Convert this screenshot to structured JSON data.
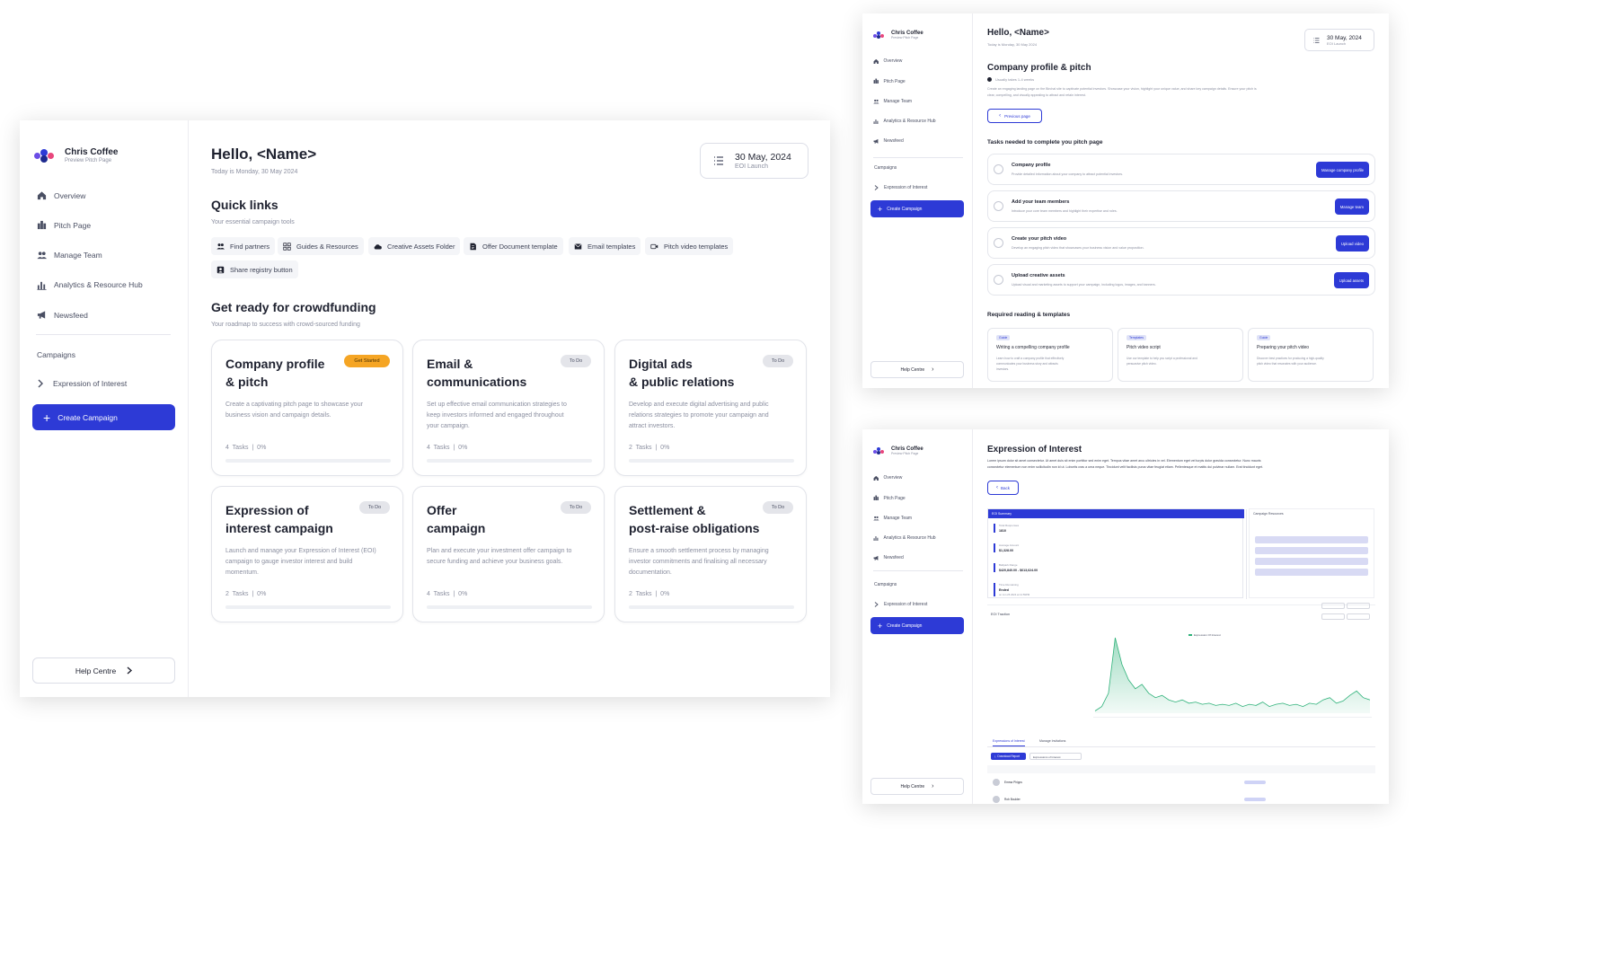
{
  "brand": {
    "name": "Chris Coffee",
    "sub": "Preview Pitch Page"
  },
  "nav": [
    {
      "label": "Overview",
      "icon": "home-icon"
    },
    {
      "label": "Pitch Page",
      "icon": "pitch-page-icon"
    },
    {
      "label": "Manage Team",
      "icon": "team-icon"
    },
    {
      "label": "Analytics & Resource Hub",
      "icon": "analytics-icon"
    },
    {
      "label": "Newsfeed",
      "icon": "megaphone-icon"
    }
  ],
  "campaigns": {
    "heading": "Campaigns",
    "item": "Expression of Interest",
    "create": "Create Campaign"
  },
  "help": "Help Centre",
  "header": {
    "hello": "Hello, <Name>",
    "today": "Today is Monday, 30 May 2024",
    "date": "30 May, 2024",
    "phase": "EOI Launch"
  },
  "quick_links": {
    "title": "Quick links",
    "sub": "Your essential campaign tools",
    "items": [
      {
        "label": "Find partners",
        "icon": "users-icon"
      },
      {
        "label": "Guides & Resources",
        "icon": "grid-icon"
      },
      {
        "label": "Creative Assets Folder",
        "icon": "cloud-icon"
      },
      {
        "label": "Offer Document template",
        "icon": "document-icon"
      },
      {
        "label": "Email templates",
        "icon": "mail-icon"
      },
      {
        "label": "Pitch video templates",
        "icon": "video-icon"
      },
      {
        "label": "Share registry button",
        "icon": "share-user-icon"
      }
    ]
  },
  "ready": {
    "title": "Get ready for crowdfunding",
    "sub": "Your roadmap to success with crowd-sourced funding"
  },
  "cards": [
    {
      "t1": "Company profile",
      "t2": "& pitch",
      "badge": "Get Started",
      "badge_color": "#f5a524",
      "desc": [
        "Create a captivating pitch page to showcase your",
        "business vision and campaign details."
      ],
      "tasks": "4  Tasks",
      "pct": "0%"
    },
    {
      "t1": "Email &",
      "t2": "communications",
      "badge": "To Do",
      "badge_color": "#e4e5ea",
      "desc": [
        "Set up effective email communication strategies to",
        "keep investors informed and engaged throughout",
        "your campaign."
      ],
      "tasks": "4  Tasks",
      "pct": "0%"
    },
    {
      "t1": "Digital ads",
      "t2": "& public relations",
      "badge": "To Do",
      "badge_color": "#e4e5ea",
      "desc": [
        "Develop and execute digital advertising and public",
        "relations strategies to promote your campaign and",
        "attract investors."
      ],
      "tasks": "2  Tasks",
      "pct": "0%"
    },
    {
      "t1": "Expression of",
      "t2": "interest campaign",
      "badge": "To Do",
      "badge_color": "#e4e5ea",
      "desc": [
        "Launch and manage your Expression of Interest (EOI)",
        "campaign to gauge investor interest and build",
        "momentum."
      ],
      "tasks": "2  Tasks",
      "pct": "0%"
    },
    {
      "t1": "Offer",
      "t2": "campaign",
      "badge": "To Do",
      "badge_color": "#e4e5ea",
      "desc": [
        "Plan and execute your investment offer campaign to",
        "secure funding and achieve your business goals."
      ],
      "tasks": "4  Tasks",
      "pct": "0%"
    },
    {
      "t1": "Settlement &",
      "t2": "post-raise obligations",
      "badge": "To Do",
      "badge_color": "#e4e5ea",
      "desc": [
        "Ensure a smooth settlement process by managing",
        "investor commitments and finalising all necessary",
        "documentation."
      ],
      "tasks": "2  Tasks",
      "pct": "0%"
    }
  ],
  "pitch": {
    "title": "Company profile & pitch",
    "duration": "Usually takes 1-4 weeks",
    "desc": [
      "Create an engaging landing page on the Birchal site to captivate potential investors. Showcase your vision, highlight your unique value, and share key campaign details. Ensure your pitch is",
      "clear, compelling, and visually appealing to attract and retain interest."
    ],
    "prev": "Previous page",
    "tasks_title": "Tasks needed to complete you pitch page",
    "tasks": [
      {
        "title": "Company profile",
        "desc": "Provide detailed information about your company to attract potential investors.",
        "btn": "Manage company profile"
      },
      {
        "title": "Add your team members",
        "desc": "Introduce your core team members and highlight their expertise and roles.",
        "btn": "Manage team"
      },
      {
        "title": "Create your pitch video",
        "desc": "Develop an engaging pitch video that showcases your business vision and value proposition.",
        "btn": "Upload video"
      },
      {
        "title": "Upload creative assets",
        "desc": "Upload visual and marketing assets to support your campaign, including logos, images, and banners.",
        "btn": "Upload assets"
      }
    ],
    "reading_title": "Required reading & templates",
    "reading": [
      {
        "tag": "Guide",
        "title": "Writing a compelling company profile",
        "desc": [
          "Learn how to craft a company profile that effectively",
          "communicates your business story and attracts",
          "investors."
        ],
        "link": "See our guide"
      },
      {
        "tag": "Templates",
        "title": "Pitch video script",
        "desc": [
          "Use our template to help you script a professional and",
          "persuasive pitch video."
        ],
        "link": "View template"
      },
      {
        "tag": "Guide",
        "title": "Preparing your pitch video",
        "desc": [
          "Discover best practices for producing a high-quality",
          "pitch video that resonates with your audience."
        ],
        "link": "See our guide"
      }
    ]
  },
  "eoi": {
    "title": "Expression of Interest",
    "desc": [
      "Lorem ipsum dolor sit amet consectetur. Ut amet duis sit enim porttitor sed enim eget. Tempus vitae amet arcu ultricies in vel. Elementum eget vel turpis dolor gravida consectetur. Nunc mauris",
      "consectetur elementum non enim sollicitudin non id ut. Lobortis cras a urna neque. Tincidunt velit facilisis purus vitae feugiat etiam. Pellentesque et mattis dui pulvinar nullam. Erat tincidunt eget."
    ],
    "back": "Back",
    "summary": "EOI Summary",
    "stats": [
      {
        "label": "Total Responses",
        "value": "1810"
      },
      {
        "label": "Average Amount",
        "value": "$1,328.00"
      },
      {
        "label": "Ballpark Range",
        "value": "$420,840.00 - $613,624.00"
      },
      {
        "label": "Time Remaining",
        "value": "Ended",
        "note": "on Jun 26 2024 at 11:59PM"
      }
    ],
    "resources": "Campaign Resources",
    "chart_label": "EOI Traction",
    "legend": "Expression Of Interest",
    "tabs": [
      "Expressions of Interest",
      "Manage Invitations"
    ],
    "download": "Download Report",
    "filter": "Expressions of Interest",
    "rows": [
      {
        "name": "Emma Phipps"
      },
      {
        "name": "Rob Boulder"
      }
    ]
  },
  "chart_data": {
    "type": "area",
    "title": "EOI Traction",
    "series": [
      {
        "name": "Expression Of Interest",
        "values": [
          2,
          6,
          18,
          68,
          44,
          30,
          22,
          26,
          18,
          14,
          16,
          12,
          10,
          12,
          9,
          10,
          8,
          9,
          7,
          8,
          7,
          9,
          6,
          8,
          7,
          10,
          6,
          8,
          9,
          7,
          8,
          6,
          9,
          8,
          12,
          14,
          9,
          11,
          16,
          20,
          14,
          12
        ]
      }
    ],
    "color": "#2fb27a"
  },
  "colors": {
    "primary": "#2d3ad6",
    "badge_orange": "#f5a524",
    "area_green": "#2fb27a"
  }
}
